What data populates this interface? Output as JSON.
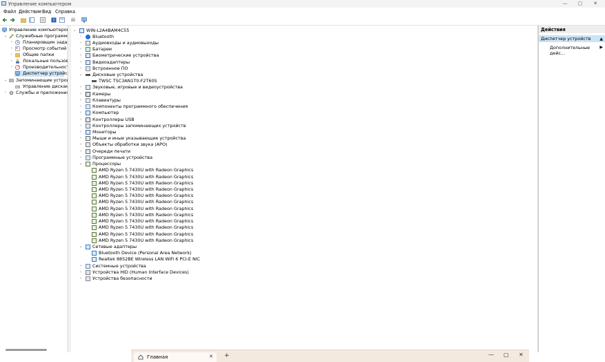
{
  "window": {
    "title": "Управление компьютером",
    "minimize": "—",
    "maximize": "▢",
    "close": "✕"
  },
  "menu": [
    "Файл",
    "Действие",
    "Вид",
    "Справка"
  ],
  "tree": {
    "root": "Управление компьютером (лс",
    "utilities": "Служебные программы",
    "utilities_items": [
      "Планировщик задач",
      "Просмотр событий",
      "Общие папки",
      "Локальные пользовате",
      "Производительность",
      "Диспетчер устройств"
    ],
    "storage": "Запоминающие устройств",
    "storage_items": [
      "Управление дисками"
    ],
    "services": "Службы и приложения"
  },
  "devices": {
    "computer": "WIN-L2A4BAM4C55",
    "categories": [
      {
        "label": "Bluetooth",
        "icon": "bluetooth-icon",
        "expanded": false
      },
      {
        "label": "Аудиовходы и аудиовыходы",
        "icon": "speaker-icon",
        "expanded": false
      },
      {
        "label": "Батареи",
        "icon": "battery-icon",
        "expanded": false
      },
      {
        "label": "Биометрические устройства",
        "icon": "fingerprint-icon",
        "expanded": false
      },
      {
        "label": "Видеоадаптеры",
        "icon": "display-adapter-icon",
        "expanded": false
      },
      {
        "label": "Встроенное ПО",
        "icon": "firmware-icon",
        "expanded": false
      },
      {
        "label": "Дисковые устройства",
        "icon": "disk-icon",
        "expanded": true,
        "children": [
          "TWSC TSC3AN1T0-F2T60S"
        ]
      },
      {
        "label": "Звуковые, игровые и видеоустройства",
        "icon": "sound-icon",
        "expanded": false
      },
      {
        "label": "Камеры",
        "icon": "camera-icon",
        "expanded": false
      },
      {
        "label": "Клавиатуры",
        "icon": "keyboard-icon",
        "expanded": false
      },
      {
        "label": "Компоненты программного обеспечения",
        "icon": "software-component-icon",
        "expanded": false
      },
      {
        "label": "Компьютер",
        "icon": "computer-icon",
        "expanded": false
      },
      {
        "label": "Контроллеры USB",
        "icon": "usb-icon",
        "expanded": false
      },
      {
        "label": "Контроллеры запоминающих устройств",
        "icon": "storage-controller-icon",
        "expanded": false
      },
      {
        "label": "Мониторы",
        "icon": "monitor-icon",
        "expanded": false
      },
      {
        "label": "Мыши и иные указывающие устройства",
        "icon": "mouse-icon",
        "expanded": false
      },
      {
        "label": "Объекты обработки звука (APO)",
        "icon": "audio-processing-icon",
        "expanded": false
      },
      {
        "label": "Очереди печати",
        "icon": "printer-icon",
        "expanded": false
      },
      {
        "label": "Программные устройства",
        "icon": "software-device-icon",
        "expanded": false
      },
      {
        "label": "Процессоры",
        "icon": "processor-icon",
        "expanded": true,
        "children": [
          "AMD Ryzen 5 7430U with Radeon Graphics",
          "AMD Ryzen 5 7430U with Radeon Graphics",
          "AMD Ryzen 5 7430U with Radeon Graphics",
          "AMD Ryzen 5 7430U with Radeon Graphics",
          "AMD Ryzen 5 7430U with Radeon Graphics",
          "AMD Ryzen 5 7430U with Radeon Graphics",
          "AMD Ryzen 5 7430U with Radeon Graphics",
          "AMD Ryzen 5 7430U with Radeon Graphics",
          "AMD Ryzen 5 7430U with Radeon Graphics",
          "AMD Ryzen 5 7430U with Radeon Graphics",
          "AMD Ryzen 5 7430U with Radeon Graphics",
          "AMD Ryzen 5 7430U with Radeon Graphics"
        ]
      },
      {
        "label": "Сетевые адаптеры",
        "icon": "network-adapter-icon",
        "expanded": true,
        "children": [
          "Bluetooth Device (Personal Area Network)",
          "Realtek 8852BE Wireless LAN WiFi 6 PCI-E NIC"
        ]
      },
      {
        "label": "Системные устройства",
        "icon": "system-device-icon",
        "expanded": false
      },
      {
        "label": "Устройства HID (Human Interface Devices)",
        "icon": "hid-icon",
        "expanded": false
      },
      {
        "label": "Устройства безопасности",
        "icon": "security-device-icon",
        "expanded": false
      }
    ]
  },
  "actions": {
    "title": "Действия",
    "selected": "Диспетчер устройств",
    "more": "Дополнительные дейс..."
  },
  "browser": {
    "tab_label": "Главная",
    "tab_close": "✕",
    "new_tab": "+",
    "minimize": "—",
    "maximize": "▢",
    "close": "✕"
  },
  "colors": {
    "selection": "#cce4f7",
    "browser_bar": "#f4e9df"
  }
}
